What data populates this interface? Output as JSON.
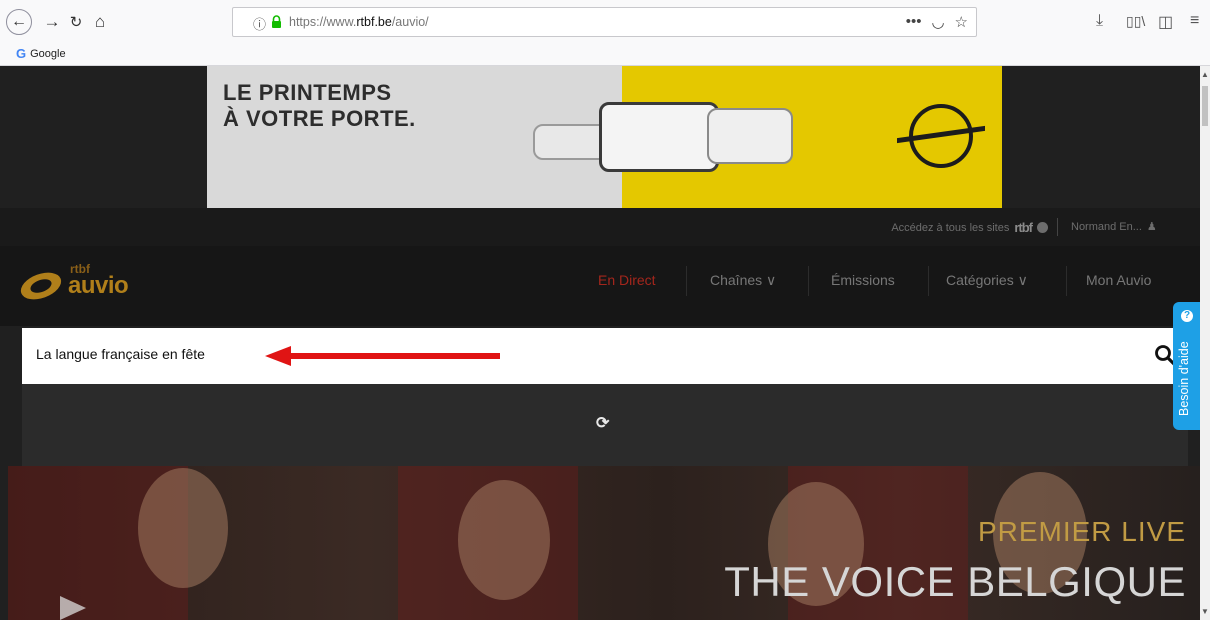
{
  "browser": {
    "url_host": "https://www.",
    "url_domain": "rtbf.be",
    "url_path": "/auvio/",
    "info_icon": "info-icon",
    "bookmark_label": "Google",
    "bookmark_icon": "G",
    "page_actions": [
      "•••",
      "⊤",
      "☆"
    ],
    "toolbar_icons": [
      "download-icon",
      "library-icon",
      "sidebar-icon",
      "menu-icon"
    ]
  },
  "ad": {
    "headline_line1": "LE PRINTEMPS",
    "headline_line2": "À VOTRE PORTE."
  },
  "topbar": {
    "sites_text": "Accédez à tous les sites",
    "rtbf_logo": "rtbf",
    "user_name": "Normand En..."
  },
  "nav": {
    "logo_top": "rtbf",
    "logo_main": "auvio",
    "items": [
      {
        "label": "En Direct"
      },
      {
        "label": "Chaînes ∨"
      },
      {
        "label": "Émissions"
      },
      {
        "label": "Catégories ∨"
      },
      {
        "label": "Mon Auvio"
      }
    ]
  },
  "search": {
    "value": "La langue française en fête"
  },
  "hero": {
    "subtitle": "PREMIER LIVE",
    "title": "THE VOICE BELGIQUE"
  },
  "help": {
    "label": "Besoin d'aide",
    "icon": "?"
  },
  "colors": {
    "accent_red": "#a4261c",
    "auvio_gold": "#b07f1a",
    "help_blue": "#1ea0e6",
    "arrow_red": "#e01414"
  }
}
